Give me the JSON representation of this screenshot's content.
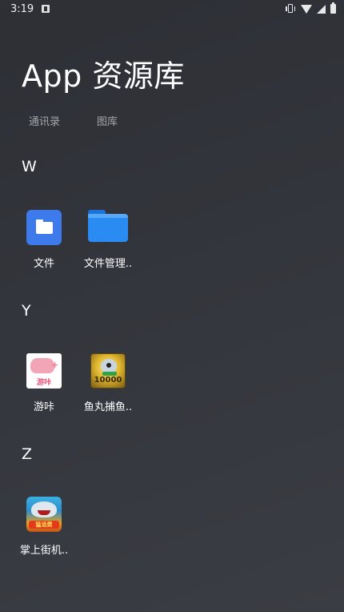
{
  "status_bar": {
    "time": "3:19"
  },
  "page": {
    "title": "App 资源库"
  },
  "tabs": [
    {
      "label": "通讯录"
    },
    {
      "label": "图库"
    }
  ],
  "sections": [
    {
      "letter": "W",
      "apps": [
        {
          "label": "文件",
          "icon": "files-icon"
        },
        {
          "label": "文件管理..",
          "icon": "file-manager-icon"
        }
      ]
    },
    {
      "letter": "Y",
      "apps": [
        {
          "label": "游咔",
          "icon": "youka-icon",
          "icon_text": "游咔"
        },
        {
          "label": "鱼丸捕鱼..",
          "icon": "fish-game-icon",
          "icon_text": "10000"
        }
      ]
    },
    {
      "letter": "Z",
      "apps": [
        {
          "label": "掌上街机..",
          "icon": "arcade-game-icon",
          "icon_text": "猛话费"
        }
      ]
    }
  ],
  "colors": {
    "background": "#2d2f35",
    "tab_text": "#a3a6ab",
    "files_blue": "#3d7bed",
    "folder_blue": "#2a8cf2"
  }
}
